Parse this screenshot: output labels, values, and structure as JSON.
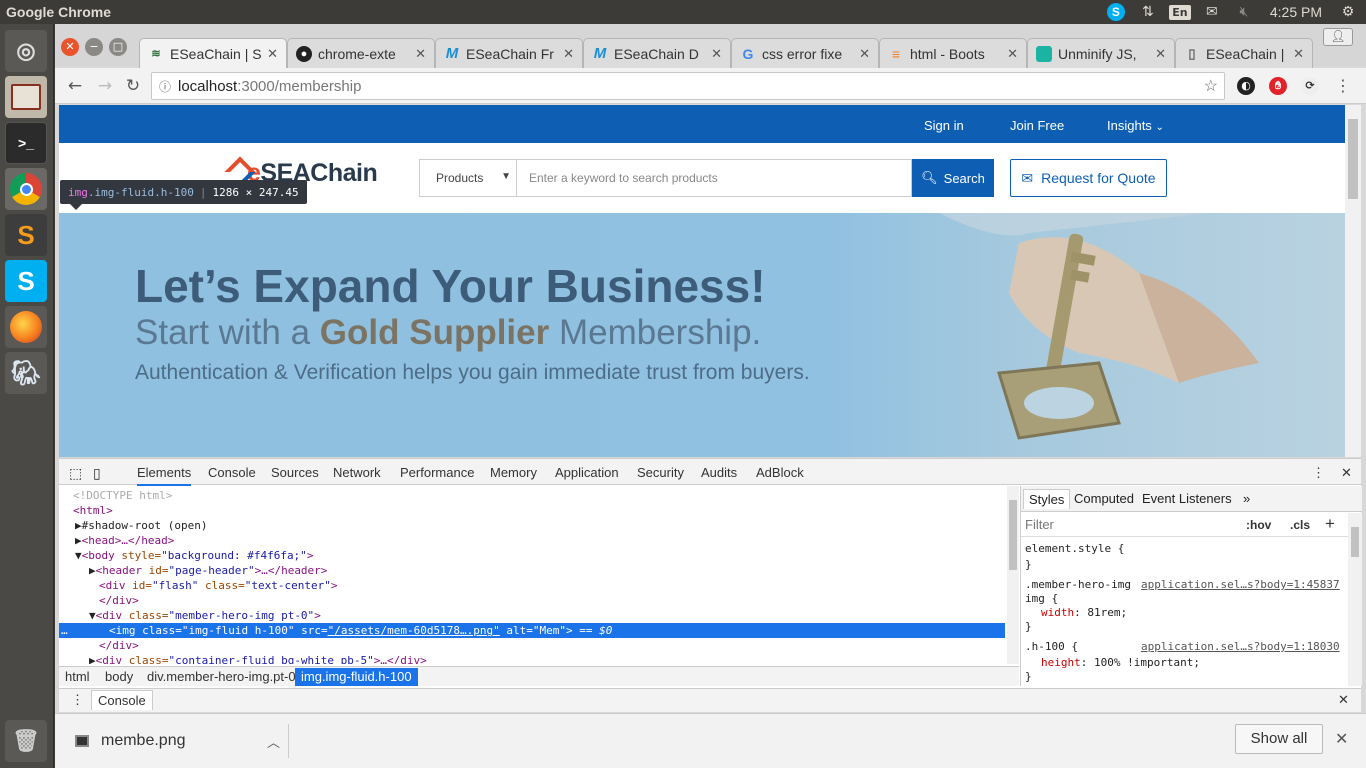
{
  "os": {
    "app_name": "Google Chrome",
    "clock": "4:25 PM",
    "keyboard_layout": "En"
  },
  "tabs": [
    {
      "title": "ESeaChain | S",
      "icon": "eseachain-icon",
      "active": true
    },
    {
      "title": "chrome-exte",
      "icon": "github-icon"
    },
    {
      "title": "ESeaChain Fr",
      "icon": "eseachain-m-icon"
    },
    {
      "title": "ESeaChain D",
      "icon": "eseachain-m-icon"
    },
    {
      "title": "css error fixe",
      "icon": "google-icon"
    },
    {
      "title": "html - Boots",
      "icon": "stackoverflow-icon"
    },
    {
      "title": "Unminify JS,",
      "icon": "unminify-icon"
    },
    {
      "title": "ESeaChain | S",
      "icon": "page-icon"
    }
  ],
  "address": {
    "host": "localhost",
    "path": ":3000/membership"
  },
  "site": {
    "nav": {
      "signin": "Sign in",
      "join": "Join Free",
      "insights": "Insights"
    },
    "logo": {
      "e": "e",
      "rest": "SEAChain"
    },
    "products_select": "Products",
    "search_placeholder": "Enter a keyword to search products",
    "search_button": "Search",
    "rfq_button": "Request for Quote",
    "hero": {
      "headline": "Let’s Expand Your Business!",
      "sub_prefix": "Start with a ",
      "sub_bold": "Gold Supplier",
      "sub_suffix": " Membership.",
      "tagline": "Authentication & Verification helps you gain immediate trust from buyers."
    }
  },
  "tooltip": {
    "tag": "img",
    "cls": ".img-fluid.h-100",
    "size": "1286 × 247.45"
  },
  "devtools": {
    "tabs": [
      "Elements",
      "Console",
      "Sources",
      "Network",
      "Performance",
      "Memory",
      "Application",
      "Security",
      "Audits",
      "AdBlock"
    ],
    "dom": {
      "doctype": "<!DOCTYPE html>",
      "html_open": "<html>",
      "shadow": "#shadow-root (open)",
      "head": "<head>…</head>",
      "body_tag": "<body",
      "body_attr": " style=",
      "body_val": "\"background: #f4f6fa;\"",
      "body_close": ">",
      "header_tag": "<header",
      "header_attr": " id=",
      "header_val": "\"page-header\"",
      "header_close": ">…</header>",
      "flash_tag": "<div",
      "flash_attr1": " id=",
      "flash_val1": "\"flash\"",
      "flash_attr2": " class=",
      "flash_val2": "\"text-center\"",
      "flash_close": ">",
      "div_end": "</div>",
      "hero_tag": "<div",
      "hero_attr": " class=",
      "hero_val": "\"member-hero-img pt-0\"",
      "hero_close": ">",
      "img_dots": "…",
      "img_tag": "<img",
      "img_attr1": " class=",
      "img_val1": "\"img-fluid h-100\"",
      "img_attr2": " src=",
      "img_val2": "\"/assets/mem-60d5178….png\"",
      "img_attr3": " alt=",
      "img_val3": "\"Mem\"",
      "img_close": ">",
      "img_eq": " == $0",
      "div2_end": "</div>",
      "cf_tag": "<div",
      "cf_attr": " class=",
      "cf_val": "\"container-fluid bg-white pb-5\"",
      "cf_close": ">…</div>"
    },
    "breadcrumbs": [
      "html",
      "body",
      "div.member-hero-img.pt-0",
      "img.img-fluid.h-100"
    ],
    "styles_tabs": [
      "Styles",
      "Computed",
      "Event Listeners"
    ],
    "filter_placeholder": "Filter",
    "hov": ":hov",
    "cls": ".cls",
    "rules": {
      "element_style": "element.style {",
      "close": "}",
      "r1_sel": ".member-hero-img",
      "r1_sel2": "img {",
      "r1_link": "application.sel…s?body=1:45837",
      "r1_prop": "width",
      "r1_val": ": 81rem;",
      "r2_sel": ".h-100 {",
      "r2_link": "application.sel…s?body=1:18030",
      "r2_prop": "height",
      "r2_val": ": 100% !important;"
    },
    "drawer_tab": "Console"
  },
  "download": {
    "filename": "membe.png",
    "show_all": "Show all"
  }
}
